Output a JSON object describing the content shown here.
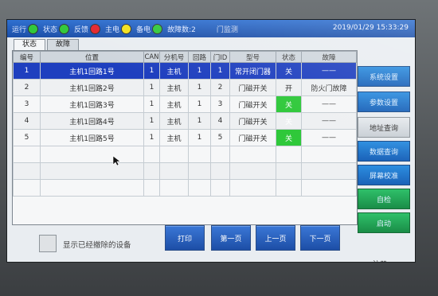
{
  "status_bar": {
    "indicators": [
      {
        "label": "运行",
        "color": "#2fc83a"
      },
      {
        "label": "状态",
        "color": "#2fc83a"
      },
      {
        "label": "反馈",
        "color": "#e3242b"
      },
      {
        "label": "主电",
        "color": "#f2e21c"
      },
      {
        "label": "备电",
        "color": "#2fc83a"
      }
    ],
    "fault_text": "故障数:2",
    "screen_title": "门监测",
    "datetime": "2019/01/29 15:33:29"
  },
  "tabs": [
    {
      "label": "状态",
      "active": true
    },
    {
      "label": "故障",
      "active": false
    }
  ],
  "table": {
    "headers": [
      "编号",
      "位置",
      "CAN",
      "分机号",
      "回路",
      "门ID",
      "型号",
      "状态",
      "故障"
    ],
    "rows": [
      {
        "no": "1",
        "location": "主机1回路1号",
        "can": "1",
        "ext": "主机",
        "loop": "1",
        "door": "1",
        "model": "常开闭门器",
        "state": "关",
        "fault": "——",
        "selected": true
      },
      {
        "no": "2",
        "location": "主机1回路2号",
        "can": "1",
        "ext": "主机",
        "loop": "1",
        "door": "2",
        "model": "门磁开关",
        "state": "开",
        "fault": "防火门故障",
        "selected": false
      },
      {
        "no": "3",
        "location": "主机1回路3号",
        "can": "1",
        "ext": "主机",
        "loop": "1",
        "door": "3",
        "model": "门磁开关",
        "state": "关",
        "fault": "——",
        "selected": false
      },
      {
        "no": "4",
        "location": "主机1回路4号",
        "can": "1",
        "ext": "主机",
        "loop": "1",
        "door": "4",
        "model": "门磁开关",
        "state": "关",
        "fault": "——",
        "selected": false
      },
      {
        "no": "5",
        "location": "主机1回路5号",
        "can": "1",
        "ext": "主机",
        "loop": "1",
        "door": "5",
        "model": "门磁开关",
        "state": "关",
        "fault": "——",
        "selected": false
      }
    ]
  },
  "show_removed_label": "显示已经撤除的设备",
  "bottom_buttons": {
    "print": "打印",
    "first": "第一页",
    "prev": "上一页",
    "next": "下一页"
  },
  "side_buttons": {
    "system_settings": "系统设置",
    "param_settings": "参数设置",
    "address_query": "地址查询",
    "record_query": "数据查询",
    "screen_calibrate": "屏幕校准",
    "self_check": "自检",
    "startup": "启动",
    "register": "注册"
  }
}
